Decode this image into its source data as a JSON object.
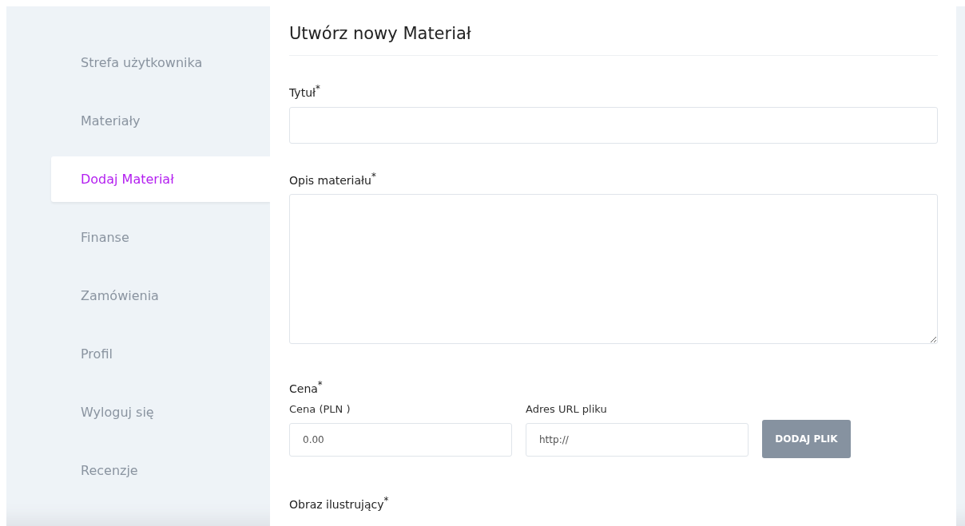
{
  "sidebar": {
    "items": [
      {
        "label": "Strefa użytkownika",
        "selected": false
      },
      {
        "label": "Materiały",
        "selected": false
      },
      {
        "label": "Dodaj Materiał",
        "selected": true
      },
      {
        "label": "Finanse",
        "selected": false
      },
      {
        "label": "Zamówienia",
        "selected": false
      },
      {
        "label": "Profil",
        "selected": false
      },
      {
        "label": "Wyloguj się",
        "selected": false
      },
      {
        "label": "Recenzje",
        "selected": false
      }
    ]
  },
  "form": {
    "title": "Utwórz nowy Materiał",
    "title_field": {
      "label": "Tytuł$^{*}$"
    },
    "description_field": {
      "label": "Opis materiału$^{*}$"
    },
    "price_section": {
      "label": "Cena$^{*}$",
      "price_field": {
        "label": "Cena (PLN )",
        "placeholder": "0.00"
      },
      "url_field": {
        "label": "Adres URL pliku",
        "placeholder": "http://"
      },
      "add_file_button": "DODAJ PLIK"
    },
    "image_field": {
      "label": "Obraz ilustrujący$^{*}$"
    }
  }
}
